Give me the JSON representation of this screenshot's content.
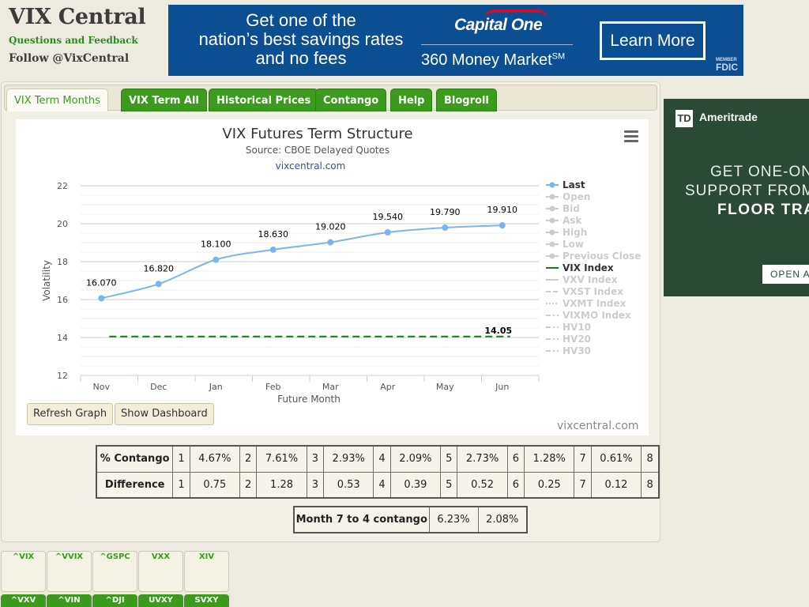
{
  "header": {
    "title": "VIX Central",
    "feedback": "Questions and Feedback",
    "follow": "Follow @VixCentral"
  },
  "top_ad": {
    "headline_1": "Get one of the",
    "headline_2": "nation’s best savings rates",
    "headline_3": "and no fees",
    "brand": "Capital One",
    "product": "360 Money Market",
    "product_sup": "SM",
    "cta": "Learn More",
    "fdic_member": "MEMBER",
    "fdic": "FDIC",
    "colors": {
      "background": "#0b4e92",
      "swoosh": "#c8102e"
    }
  },
  "tabs": [
    {
      "label": "VIX Term Months",
      "active": true
    },
    {
      "label": "VIX Term All",
      "active": false
    },
    {
      "label": "Historical Prices",
      "active": false
    },
    {
      "label": "Contango",
      "active": false
    },
    {
      "label": "Help",
      "active": false
    },
    {
      "label": "Blogroll",
      "active": false
    }
  ],
  "chart_data": {
    "type": "line",
    "title": "VIX Futures Term Structure",
    "subtitle": "Source: CBOE Delayed Quotes",
    "link": "vixcentral.com",
    "xlabel": "Future Month",
    "ylabel": "Volatility",
    "categories": [
      "Nov",
      "Dec",
      "Jan",
      "Feb",
      "Mar",
      "Apr",
      "May",
      "Jun"
    ],
    "ylim": [
      12,
      22
    ],
    "yticks": [
      12,
      14,
      16,
      18,
      20,
      22
    ],
    "grid": true,
    "series": [
      {
        "name": "Last",
        "color": "#7cb5ec",
        "values": [
          16.07,
          16.82,
          18.1,
          18.63,
          19.02,
          19.54,
          19.79,
          19.91
        ],
        "labels": [
          "16.070",
          "16.820",
          "18.100",
          "18.630",
          "19.020",
          "19.540",
          "19.790",
          "19.910"
        ]
      },
      {
        "name": "VIX Index",
        "color": "#1a7a1a",
        "dashed": true,
        "constant": 14.05,
        "label": "14.05"
      }
    ],
    "legend_position": "right",
    "legend": [
      {
        "name": "Last",
        "active": true,
        "style": "line-dot",
        "color": "#7cb5ec"
      },
      {
        "name": "Open",
        "active": false,
        "style": "line-diamond"
      },
      {
        "name": "Bid",
        "active": false,
        "style": "line-square"
      },
      {
        "name": "Ask",
        "active": false,
        "style": "line-triangle"
      },
      {
        "name": "High",
        "active": false,
        "style": "line-triangle-down"
      },
      {
        "name": "Low",
        "active": false,
        "style": "line-dot"
      },
      {
        "name": "Previous Close",
        "active": false,
        "style": "line-diamond"
      },
      {
        "name": "VIX Index",
        "active": true,
        "style": "line",
        "color": "#1a7a1a"
      },
      {
        "name": "VXV Index",
        "active": false,
        "style": "line"
      },
      {
        "name": "VXST Index",
        "active": false,
        "style": "dash"
      },
      {
        "name": "VXMT Index",
        "active": false,
        "style": "dot"
      },
      {
        "name": "VIXMO Index",
        "active": false,
        "style": "dashdot"
      },
      {
        "name": "HV10",
        "active": false,
        "style": "dashdot"
      },
      {
        "name": "HV20",
        "active": false,
        "style": "dashdot"
      },
      {
        "name": "HV30",
        "active": false,
        "style": "dashdot"
      }
    ]
  },
  "buttons": {
    "refresh": "Refresh Graph",
    "dashboard": "Show Dashboard"
  },
  "watermark": "vixcentral.com",
  "contango_table": {
    "rows": [
      {
        "label": "% Contango",
        "cells": [
          [
            "1",
            "4.67%"
          ],
          [
            "2",
            "7.61%"
          ],
          [
            "3",
            "2.93%"
          ],
          [
            "4",
            "2.09%"
          ],
          [
            "5",
            "2.73%"
          ],
          [
            "6",
            "1.28%"
          ],
          [
            "7",
            "0.61%"
          ]
        ],
        "last": "8"
      },
      {
        "label": "Difference",
        "cells": [
          [
            "1",
            "0.75"
          ],
          [
            "2",
            "1.28"
          ],
          [
            "3",
            "0.53"
          ],
          [
            "4",
            "0.39"
          ],
          [
            "5",
            "0.52"
          ],
          [
            "6",
            "0.25"
          ],
          [
            "7",
            "0.12"
          ]
        ],
        "last": "8"
      }
    ]
  },
  "month74": {
    "label": "Month 7 to 4 contango",
    "v1": "6.23%",
    "v2": "2.08%"
  },
  "side_ad": {
    "logo": "TD",
    "brand": "Ameritrade",
    "line1": "GET ONE-ON",
    "line2": "SUPPORT FROM",
    "line3": "FLOOR TRA",
    "cta": "OPEN A",
    "colors": {
      "background": "#2b4a36"
    }
  },
  "tiles_top": [
    "^VIX",
    "^VVIX",
    "^GSPC",
    "VXX",
    "XIV"
  ],
  "tiles_bottom": [
    "^VXV",
    "^VIN",
    "^DJI",
    "UVXY",
    "SVXY"
  ]
}
